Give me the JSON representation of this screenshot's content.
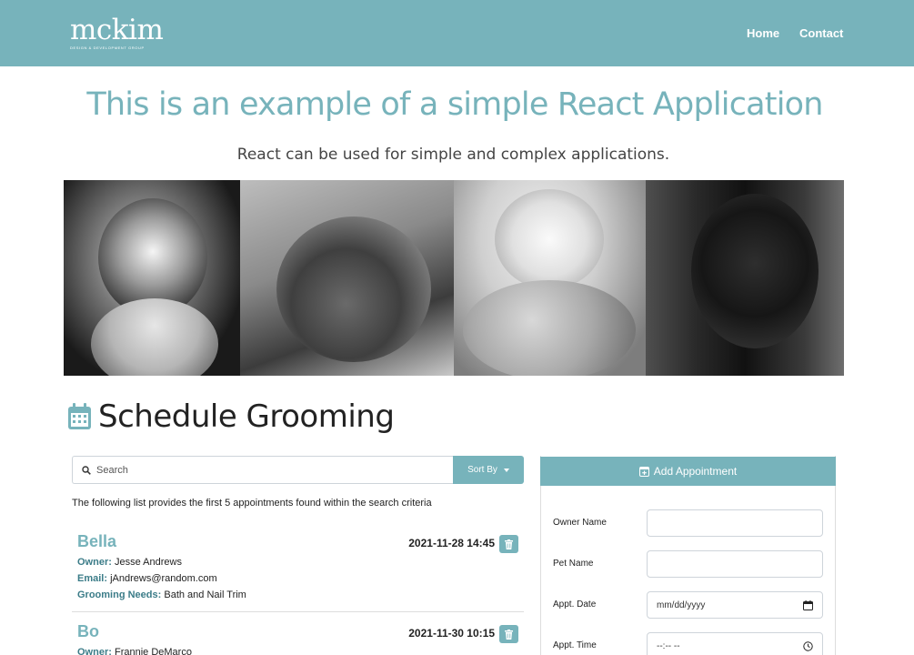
{
  "nav": {
    "logo_main": "mckim",
    "logo_sub": "DESIGN & DEVELOPMENT GROUP",
    "links": [
      "Home",
      "Contact"
    ]
  },
  "hero": {
    "title": "This is an example of a simple React Application",
    "subtitle": "React can be used for simple and complex applications."
  },
  "section": {
    "title": "Schedule Grooming"
  },
  "search": {
    "placeholder": "Search",
    "sort_label": "Sort By",
    "info": "The following list provides the first 5 appointments found within the search criteria"
  },
  "appointments": [
    {
      "pet": "Bella",
      "date": "2021-11-28 14:45",
      "owner_label": "Owner:",
      "owner": "Jesse Andrews",
      "email_label": "Email:",
      "email": "jAndrews@random.com",
      "needs_label": "Grooming Needs:",
      "needs": "Bath and Nail Trim"
    },
    {
      "pet": "Bo",
      "date": "2021-11-30 10:15",
      "owner_label": "Owner:",
      "owner": "Frannie DeMarco"
    }
  ],
  "add_form": {
    "header": "Add Appointment",
    "fields": [
      {
        "label": "Owner Name",
        "value": ""
      },
      {
        "label": "Pet Name",
        "value": ""
      },
      {
        "label": "Appt. Date",
        "value": "mm/dd/yyyy"
      },
      {
        "label": "Appt. Time",
        "value": "--:-- --"
      }
    ]
  },
  "colors": {
    "accent": "#77b3bb"
  },
  "icons": {
    "section": "calendar-icon",
    "search": "search-icon",
    "delete": "trash-icon",
    "add": "calendar-plus-icon",
    "date": "calendar-icon",
    "time": "clock-icon"
  }
}
